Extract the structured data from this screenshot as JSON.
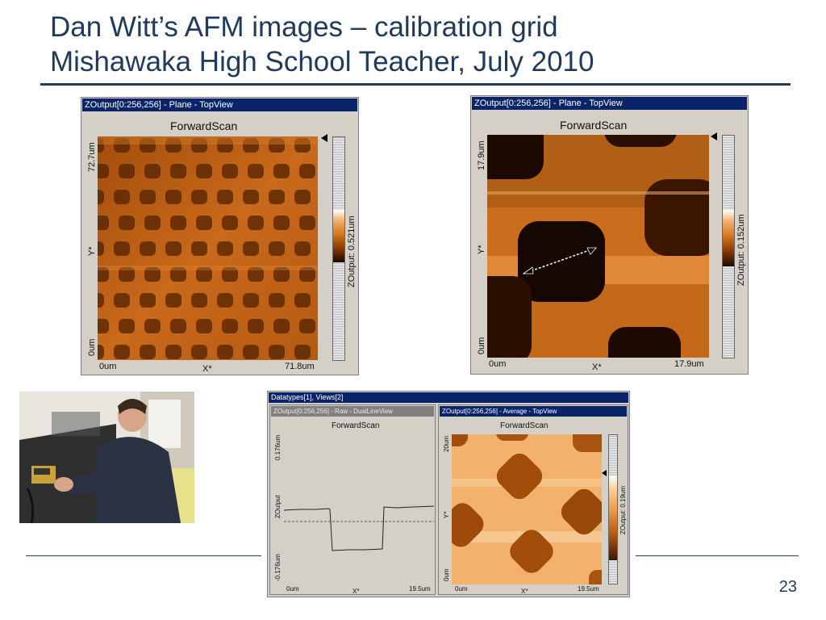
{
  "slide": {
    "title_line1": "Dan Witt’s AFM images – calibration grid",
    "title_line2": "Mishawaka High School Teacher, July 2010",
    "page_number": "23"
  },
  "colors": {
    "title": "#1f3a5a",
    "window_title_bar": "#0a246a",
    "afm_dark": "#3a1600",
    "afm_mid": "#d8781e",
    "afm_light": "#f6c88e"
  },
  "afm_left": {
    "window_title": "ZOutput[0:256,256] - Plane - TopView",
    "scan_label": "ForwardScan",
    "y_top": "72.7um",
    "y_axis": "Y*",
    "y_bottom": "0um",
    "x_left": "0um",
    "x_axis": "X*",
    "x_right": "71.8um",
    "z_label": "ZOutput: 0.521um"
  },
  "afm_right": {
    "window_title": "ZOutput[0:256,256] - Plane - TopView",
    "scan_label": "ForwardScan",
    "y_top": "17.9um",
    "y_axis": "Y*",
    "y_bottom": "0um",
    "x_left": "0um",
    "x_axis": "X*",
    "x_right": "17.9um",
    "z_label": "ZOutput: 0.152um"
  },
  "bottom_window": {
    "title": "Datatypes[1], Views[2]",
    "line_panel": {
      "title": "ZOutput[0:256,256] - Raw - DualLineView",
      "scan_label": "ForwardScan",
      "y_top": "0.176um",
      "y_axis": "ZOutput",
      "y_bottom": "-0.176um",
      "x_left": "0um",
      "x_axis": "X*",
      "x_right": "19.5um"
    },
    "top_panel": {
      "title": "ZOutput[0:256,256] - Average - TopView",
      "scan_label": "ForwardScan",
      "y_top": "20um",
      "y_axis": "Y*",
      "y_bottom": "0um",
      "x_left": "0um",
      "x_axis": "X*",
      "x_right": "19.5um",
      "z_label": "ZOutput: 0.19um"
    }
  }
}
